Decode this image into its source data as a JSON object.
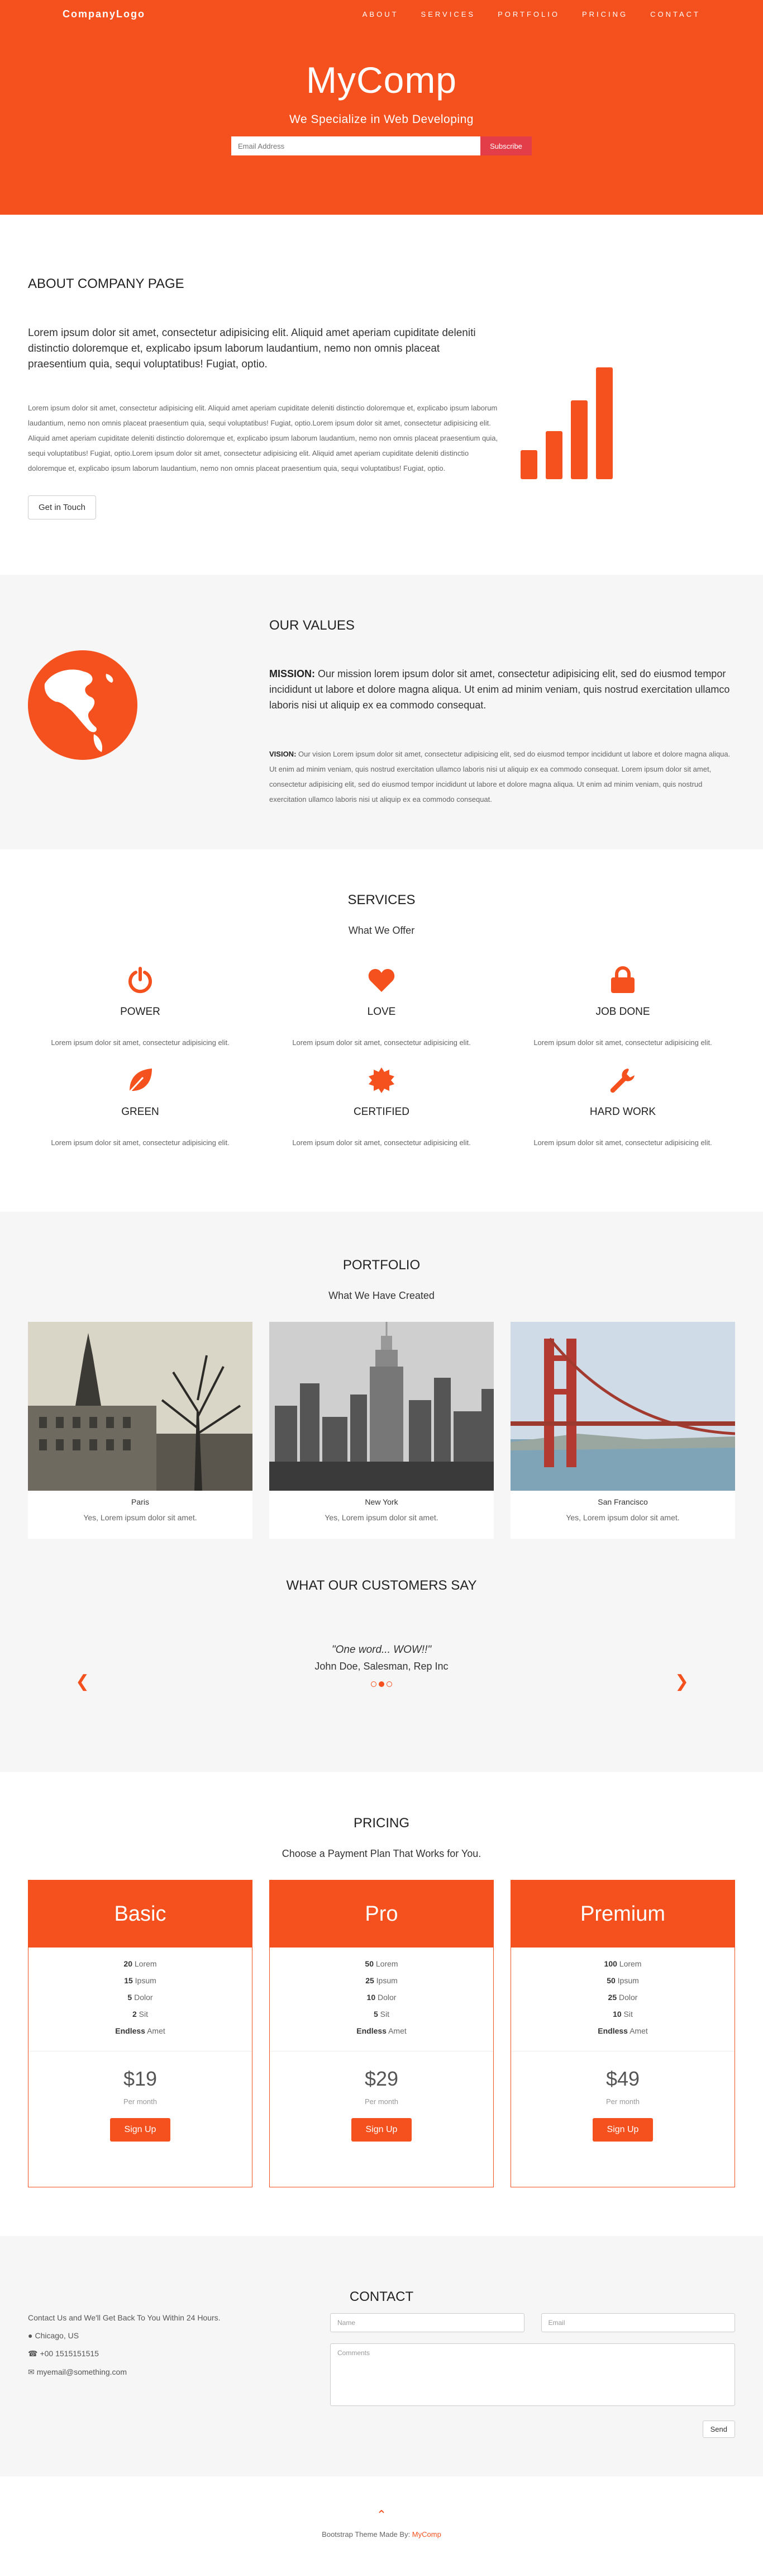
{
  "nav": {
    "brand": "CompanyLogo",
    "links": [
      "ABOUT",
      "SERVICES",
      "PORTFOLIO",
      "PRICING",
      "CONTACT"
    ]
  },
  "hero": {
    "title": "MyComp",
    "tagline": "We Specialize in Web Developing",
    "email_placeholder": "Email Address",
    "subscribe_label": "Subscribe"
  },
  "about": {
    "title": "ABOUT COMPANY PAGE",
    "lead": "Lorem ipsum dolor sit amet, consectetur adipisicing elit. Aliquid amet aperiam cupiditate deleniti distinctio doloremque et, explicabo ipsum laborum laudantium, nemo non omnis placeat praesentium quia, sequi voluptatibus! Fugiat, optio.",
    "body": "Lorem ipsum dolor sit amet, consectetur adipisicing elit. Aliquid amet aperiam cupiditate deleniti distinctio doloremque et, explicabo ipsum laborum laudantium, nemo non omnis placeat praesentium quia, sequi voluptatibus! Fugiat, optio.Lorem ipsum dolor sit amet, consectetur adipisicing elit. Aliquid amet aperiam cupiditate deleniti distinctio doloremque et, explicabo ipsum laborum laudantium, nemo non omnis placeat praesentium quia, sequi voluptatibus! Fugiat, optio.Lorem ipsum dolor sit amet, consectetur adipisicing elit. Aliquid amet aperiam cupiditate deleniti distinctio doloremque et, explicabo ipsum laborum laudantium, nemo non omnis placeat praesentium quia, sequi voluptatibus! Fugiat, optio.",
    "button": "Get in Touch",
    "chart_icon": "signal-bars-icon"
  },
  "values": {
    "title": "OUR VALUES",
    "mission_label": "MISSION:",
    "mission_text": " Our mission lorem ipsum dolor sit amet, consectetur adipisicing elit, sed do eiusmod tempor incididunt ut labore et dolore magna aliqua. Ut enim ad minim veniam, quis nostrud exercitation ullamco laboris nisi ut aliquip ex ea commodo consequat.",
    "vision_label": "VISION:",
    "vision_text": " Our vision Lorem ipsum dolor sit amet, consectetur adipisicing elit, sed do eiusmod tempor incididunt ut labore et dolore magna aliqua. Ut enim ad minim veniam, quis nostrud exercitation ullamco laboris nisi ut aliquip ex ea commodo consequat. Lorem ipsum dolor sit amet, consectetur adipisicing elit, sed do eiusmod tempor incididunt ut labore et dolore magna aliqua. Ut enim ad minim veniam, quis nostrud exercitation ullamco laboris nisi ut aliquip ex ea commodo consequat.",
    "icon": "globe-icon"
  },
  "services": {
    "title": "SERVICES",
    "subtitle": "What We Offer",
    "items": [
      {
        "title": "POWER",
        "text": "Lorem ipsum dolor sit amet, consectetur adipisicing elit.",
        "icon": "power-icon"
      },
      {
        "title": "LOVE",
        "text": "Lorem ipsum dolor sit amet, consectetur adipisicing elit.",
        "icon": "heart-icon"
      },
      {
        "title": "JOB DONE",
        "text": "Lorem ipsum dolor sit amet, consectetur adipisicing elit.",
        "icon": "lock-icon"
      },
      {
        "title": "GREEN",
        "text": "Lorem ipsum dolor sit amet, consectetur adipisicing elit.",
        "icon": "leaf-icon"
      },
      {
        "title": "CERTIFIED",
        "text": "Lorem ipsum dolor sit amet, consectetur adipisicing elit.",
        "icon": "certificate-icon"
      },
      {
        "title": "HARD WORK",
        "text": "Lorem ipsum dolor sit amet, consectetur adipisicing elit.",
        "icon": "wrench-icon"
      }
    ]
  },
  "portfolio": {
    "title": "PORTFOLIO",
    "subtitle": "What We Have Created",
    "items": [
      {
        "caption": "Paris",
        "desc": "Yes, Lorem ipsum dolor sit amet."
      },
      {
        "caption": "New York",
        "desc": "Yes, Lorem ipsum dolor sit amet."
      },
      {
        "caption": "San Francisco",
        "desc": "Yes, Lorem ipsum dolor sit amet."
      }
    ]
  },
  "testimonials": {
    "title": "WHAT OUR CUSTOMERS SAY",
    "quote": "\"One word... WOW!!\"",
    "author": "John Doe, Salesman, Rep Inc",
    "slides": 3,
    "active_slide": 1
  },
  "pricing": {
    "title": "PRICING",
    "subtitle": "Choose a Payment Plan That Works for You.",
    "plans": [
      {
        "name": "Basic",
        "features": [
          [
            "20",
            " Lorem"
          ],
          [
            "15",
            " Ipsum"
          ],
          [
            "5",
            " Dolor"
          ],
          [
            "2",
            " Sit"
          ],
          [
            "Endless",
            " Amet"
          ]
        ],
        "price": "$19",
        "per": "Per month",
        "button": "Sign Up"
      },
      {
        "name": "Pro",
        "features": [
          [
            "50",
            " Lorem"
          ],
          [
            "25",
            " Ipsum"
          ],
          [
            "10",
            " Dolor"
          ],
          [
            "5",
            " Sit"
          ],
          [
            "Endless",
            " Amet"
          ]
        ],
        "price": "$29",
        "per": "Per month",
        "button": "Sign Up"
      },
      {
        "name": "Premium",
        "features": [
          [
            "100",
            " Lorem"
          ],
          [
            "50",
            " Ipsum"
          ],
          [
            "25",
            " Dolor"
          ],
          [
            "10",
            " Sit"
          ],
          [
            "Endless",
            " Amet"
          ]
        ],
        "price": "$49",
        "per": "Per month",
        "button": "Sign Up"
      }
    ]
  },
  "contact": {
    "title": "CONTACT",
    "intro": "Contact Us and We'll Get Back To You Within 24 Hours.",
    "location": "Chicago, US",
    "phone": "+00 1515151515",
    "email": "myemail@something.com",
    "name_placeholder": "Name",
    "email_placeholder": "Email",
    "comments_placeholder": "Comments",
    "send": "Send"
  },
  "footer": {
    "credit": "Bootstrap Theme Made By: ",
    "credit_link": "MyComp",
    "up_icon": "chevron-up-icon"
  },
  "colors": {
    "accent": "#f4511e",
    "subscribe": "#e33d4a",
    "light_bg": "#f6f6f6"
  }
}
